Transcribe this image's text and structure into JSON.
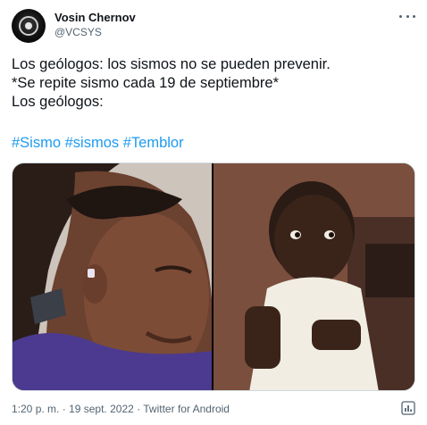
{
  "author": {
    "display_name": "Vosin Chernov",
    "handle": "@VCSYS"
  },
  "tweet": {
    "lines": [
      "Los geólogos: los sismos no se pueden prevenir.",
      "*Se repite sismo cada 19 de septiembre*",
      "Los geólogos:"
    ],
    "hashtags": [
      "#Sismo",
      "#sismos",
      "#Temblor"
    ]
  },
  "meta": {
    "time": "1:20 p. m.",
    "separator": "·",
    "date": "19 sept. 2022",
    "source": "Twitter for Android"
  },
  "icons": {
    "more": "more-horizontal-icon",
    "analytics": "analytics-icon"
  },
  "colors": {
    "text": "#0f1419",
    "secondary": "#536471",
    "link": "#1d9bf0",
    "border": "#cfd9de"
  }
}
